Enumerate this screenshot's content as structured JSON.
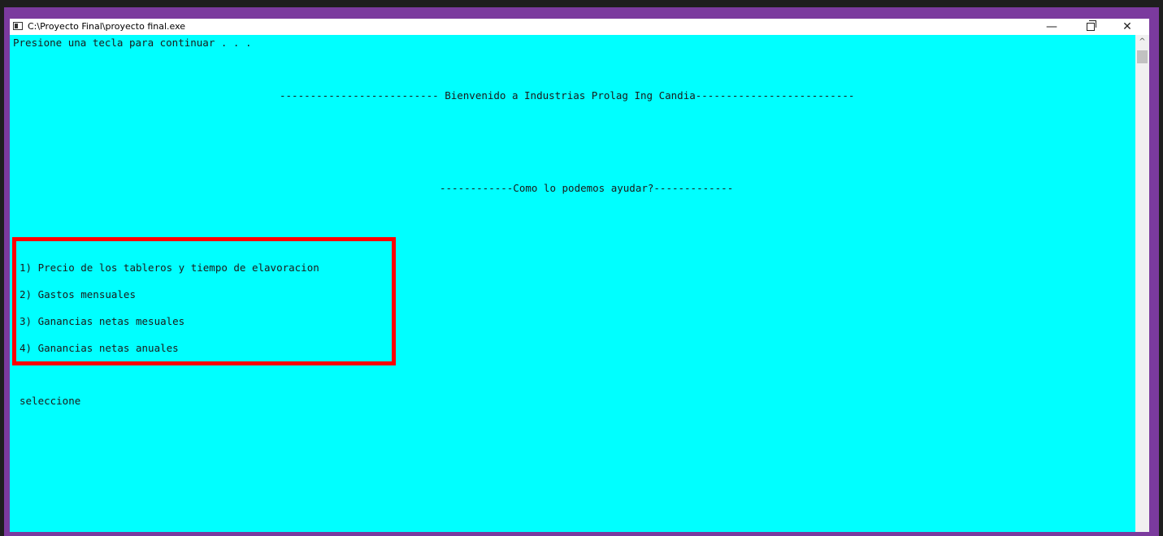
{
  "window": {
    "title": "C:\\Proyecto  Final\\proyecto final.exe",
    "minimize": "—",
    "close": "✕"
  },
  "console": {
    "prompt": "Presione una tecla para continuar . . .",
    "welcome": "-------------------------- Bienvenido a Industrias Prolag Ing Candia--------------------------",
    "question": "------------Como lo podemos ayudar?-------------",
    "options": [
      "1) Precio de los tableros y tiempo de elavoracion",
      "2) Gastos mensuales",
      "3) Ganancias netas mesuales",
      "4) Ganancias netas anuales"
    ],
    "select": "seleccione"
  },
  "scrollbar": {
    "up_arrow": "^"
  },
  "colors": {
    "console_bg": "#00ffff",
    "highlight": "#ff0000",
    "frame": "#7b3a9e"
  }
}
